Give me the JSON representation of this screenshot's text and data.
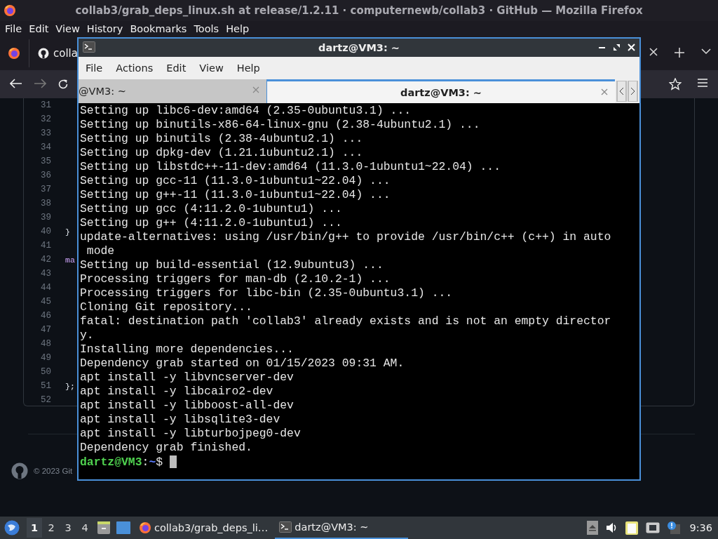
{
  "browser": {
    "title": "collab3/grab_deps_linux.sh at release/1.2.11 · computernewb/collab3 · GitHub — Mozilla Firefox",
    "menu": [
      "File",
      "Edit",
      "View",
      "History",
      "Bookmarks",
      "Tools",
      "Help"
    ],
    "tab": {
      "label": "colla"
    },
    "code_lines": [
      {
        "number": "31"
      },
      {
        "number": "32"
      },
      {
        "number": "33"
      },
      {
        "number": "34"
      },
      {
        "number": "35"
      },
      {
        "number": "36"
      },
      {
        "number": "37"
      },
      {
        "number": "38"
      },
      {
        "number": "39"
      },
      {
        "number": "40",
        "text": "}",
        "kind": "punct"
      },
      {
        "number": "41"
      },
      {
        "number": "42",
        "text": "ma",
        "kind": "name"
      },
      {
        "number": "43"
      },
      {
        "number": "44"
      },
      {
        "number": "45"
      },
      {
        "number": "46"
      },
      {
        "number": "47"
      },
      {
        "number": "48"
      },
      {
        "number": "49"
      },
      {
        "number": "50"
      },
      {
        "number": "51",
        "text": "};",
        "kind": "punct"
      },
      {
        "number": "52"
      }
    ],
    "footer": "© 2023 Git"
  },
  "terminal": {
    "title": "dartz@VM3: ~",
    "menu": [
      "File",
      "Actions",
      "Edit",
      "View",
      "Help"
    ],
    "tabs": [
      {
        "label": "@VM3: ~",
        "selected": false
      },
      {
        "label": "dartz@VM3: ~",
        "selected": true
      }
    ],
    "lines": [
      "Setting up libc6-dev:amd64 (2.35-0ubuntu3.1) ...",
      "Setting up binutils-x86-64-linux-gnu (2.38-4ubuntu2.1) ...",
      "Setting up binutils (2.38-4ubuntu2.1) ...",
      "Setting up dpkg-dev (1.21.1ubuntu2.1) ...",
      "Setting up libstdc++-11-dev:amd64 (11.3.0-1ubuntu1~22.04) ...",
      "Setting up gcc-11 (11.3.0-1ubuntu1~22.04) ...",
      "Setting up g++-11 (11.3.0-1ubuntu1~22.04) ...",
      "Setting up gcc (4:11.2.0-1ubuntu1) ...",
      "Setting up g++ (4:11.2.0-1ubuntu1) ...",
      "update-alternatives: using /usr/bin/g++ to provide /usr/bin/c++ (c++) in auto",
      " mode",
      "Setting up build-essential (12.9ubuntu3) ...",
      "Processing triggers for man-db (2.10.2-1) ...",
      "Processing triggers for libc-bin (2.35-0ubuntu3.1) ...",
      "Cloning Git repository...",
      "fatal: destination path 'collab3' already exists and is not an empty director",
      "y.",
      "Installing more dependencies...",
      "Dependency grab started on 01/15/2023 09:31 AM.",
      "apt install -y libvncserver-dev",
      "apt install -y libcairo2-dev",
      "apt install -y libboost-all-dev",
      "apt install -y libsqlite3-dev",
      "apt install -y libturbojpeg0-dev",
      "Dependency grab finished."
    ],
    "prompt": {
      "user_host": "dartz@VM3",
      "separator": ":",
      "path": "~",
      "symbol": "$"
    }
  },
  "taskbar": {
    "workspaces": [
      {
        "label": "1",
        "selected": true
      },
      {
        "label": "2",
        "selected": false
      },
      {
        "label": "3",
        "selected": false
      },
      {
        "label": "4",
        "selected": false
      }
    ],
    "tasks": [
      {
        "label": "collab3/grab_deps_li…",
        "kind": "browser",
        "selected": false
      },
      {
        "label": "dartz@VM3: ~",
        "kind": "terminal",
        "selected": true
      }
    ],
    "clock": "9:36"
  }
}
